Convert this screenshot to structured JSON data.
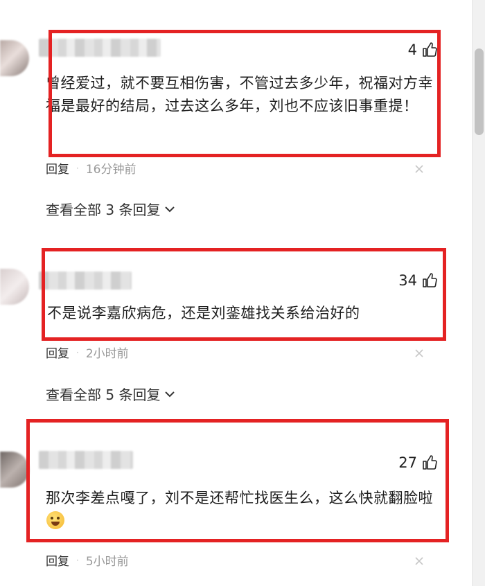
{
  "comments": [
    {
      "likes": "4",
      "text": "曾经爱过，就不要互相伤害，不管过去多少年，祝福对方幸福是最好的结局，过去这么多年，刘也不应该旧事重提！",
      "reply_label": "回复",
      "separator": "·",
      "time": "16分钟前",
      "view_replies": "查看全部 3 条回复"
    },
    {
      "likes": "34",
      "text": "不是说李嘉欣病危，还是刘銮雄找关系给治好的",
      "reply_label": "回复",
      "separator": "·",
      "time": "2小时前",
      "view_replies": "查看全部 5 条回复"
    },
    {
      "likes": "27",
      "text": "那次李差点嘎了，刘不是还帮忙找医生么，这么快就翻脸啦",
      "reply_label": "回复",
      "separator": "·",
      "time": "5小时前"
    }
  ],
  "icons": {
    "like": "thumb-up-icon",
    "close": "close-icon",
    "expand": "chevron-down-icon",
    "emoji": "laughing-crying-emoji"
  },
  "colors": {
    "highlight": "#e42223",
    "meta_text": "#999999"
  }
}
